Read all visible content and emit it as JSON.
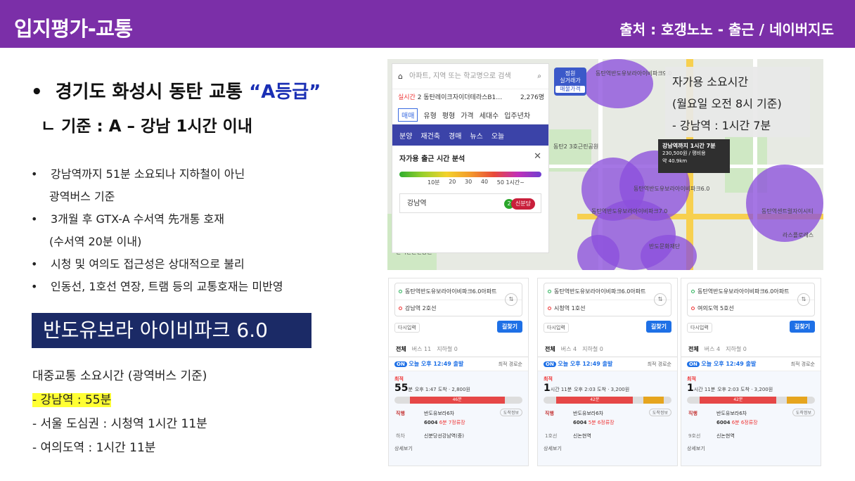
{
  "header": {
    "title": "입지평가-교통",
    "source": "출처 : 호갱노노 - 출근  / 네이버지도"
  },
  "main": {
    "bullet_prefix": "경기도 화성시 동탄 교통 ",
    "grade": "“A등급”",
    "criteria": "ㄴ 기준 : A – 강남 1시간 이내"
  },
  "points": [
    {
      "text": "강남역까지 51분 소요되나 지하철이 아닌",
      "cont": "광역버스 기준"
    },
    {
      "text": "3개월 후 GTX-A 수서역 先개통 호재",
      "cont": "(수서역 20분 이내)"
    },
    {
      "text": "시청 및 여의도 접근성은 상대적으로 불리",
      "cont": ""
    },
    {
      "text": "인동선, 1호선 연장, 트램 등의 교통호재는 미반영",
      "cont": ""
    }
  ],
  "apt_name": "반도유보라 아이비파크 6.0",
  "transit": {
    "heading": "대중교통 소요시간 (광역버스 기준)",
    "gangnam": "- 강남역 : 55분",
    "seoul": "- 서울 도심권 : 시청역 1시간 11분",
    "yeouido": "- 여의도역 : 1시간 11분"
  },
  "map": {
    "search_placeholder": "아파트, 지역 또는 학교명으로 검색",
    "live_label": "실시간",
    "live_text": "2 동탄레이크자이더테라스B1…",
    "live_count": "2,276명",
    "filters": [
      "매매",
      "유형",
      "평형",
      "가격",
      "세대수",
      "입주년차"
    ],
    "purple_tabs": [
      "분양",
      "재건축",
      "경매",
      "뉴스",
      "오늘"
    ],
    "commute_title": "자가용 출근 시간 분석",
    "ticks": [
      "10분",
      "20",
      "30",
      "40",
      "50 1시간~"
    ],
    "station": "강남역",
    "line_no": "2",
    "line_name": "신분당",
    "badge_top": "정원",
    "badge_mid": "실거래가",
    "badge_bottom": "매물가격",
    "overlay_lines": [
      "자가용 소요시간",
      "(월요일 오전 8시 기준)",
      "- 강남역 : 1시간 7분"
    ],
    "tooltip_title": "강남역까지 1시간 7분",
    "tooltip_l1": "230,500원 / 평비용",
    "tooltip_l2": "약 40.9km",
    "place_labels": [
      "동탄역반도유보라아이비파크7.0",
      "동탄역반도유보라아이비파크6.0",
      "동탄역반도유보라아이비파크9.0",
      "동탄2 3호근린공원",
      "반도문화재단",
      "반석산근린공원",
      "라스플로레스",
      "동탄역반도유보라아이비파크5.0",
      "동탄역센트럴자이시티"
    ]
  },
  "routes": [
    {
      "from": "동탄역반도유보라아이비파크6.0아파트",
      "to": "강남역 2호선",
      "reset": "다시입력",
      "search": "길찾기",
      "tabs": [
        "전체",
        "버스 11",
        "지하철 0"
      ],
      "depart": "오늘 오후 12:49 출발",
      "filter": "최적 경로순",
      "best": "최적",
      "dur_main": "55",
      "dur_unit": "분",
      "arrive": "오후 1:47 도착 · 2,800원",
      "seg_label": "46분",
      "board_label": "직행",
      "board_stop": "반도유보라6차",
      "bus_no": "6004",
      "bus_info": "6분 7정류장",
      "alight_label": "하차",
      "alight_stop": "신분당선강남역(중)",
      "more": "상세보기",
      "dr": "도착정보"
    },
    {
      "from": "동탄역반도유보라아이비파크6.0아파트",
      "to": "시청역 1호선",
      "reset": "다시입력",
      "search": "길찾기",
      "tabs": [
        "전체",
        "버스 4",
        "지하철 0"
      ],
      "depart": "오늘 오후 12:49 출발",
      "filter": "최적 경로순",
      "best": "최적",
      "dur_main": "1",
      "dur_unit": "시간 11분",
      "arrive": "오후 2:03 도착 · 3,200원",
      "seg_label": "42분",
      "board_label": "직행",
      "board_stop": "반도유보라6차",
      "bus_no": "6004",
      "bus_info": "5분 6정류장",
      "alight_label": "1호선",
      "alight_stop": "신논현역",
      "more": "상세보기",
      "dr": "도착정보"
    },
    {
      "from": "동탄역반도유보라아이비파크6.0아파트",
      "to": "여의도역 5호선",
      "reset": "다시입력",
      "search": "길찾기",
      "tabs": [
        "전체",
        "버스 4",
        "지하철 0"
      ],
      "depart": "오늘 오후 12:49 출발",
      "filter": "최적 경로순",
      "best": "최적",
      "dur_main": "1",
      "dur_unit": "시간 11분",
      "arrive": "오후 2:03 도착 · 3,200원",
      "seg_label": "42분",
      "board_label": "직행",
      "board_stop": "반도유보라6차",
      "bus_no": "6004",
      "bus_info": "6분 6정류장",
      "alight_label": "9호선",
      "alight_stop": "신논현역",
      "more": "상세보기",
      "dr": "도착정보"
    }
  ]
}
